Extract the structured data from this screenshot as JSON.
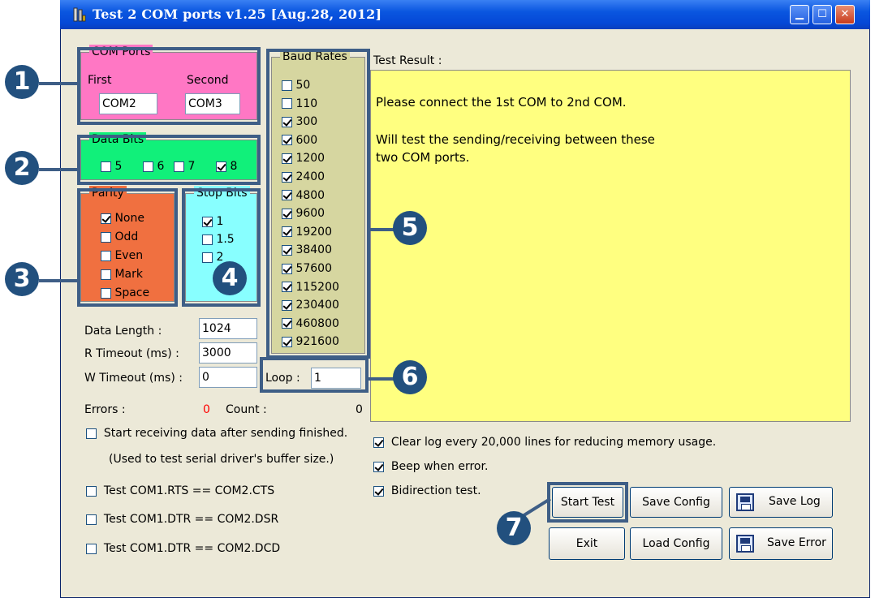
{
  "window": {
    "title": "Test 2 COM ports v1.25 [Aug.28, 2012]"
  },
  "callouts": [
    "1",
    "2",
    "3",
    "4",
    "5",
    "6",
    "7"
  ],
  "com_ports": {
    "title": "COM Ports",
    "first_label": "First",
    "second_label": "Second",
    "first_value": "COM2",
    "second_value": "COM3"
  },
  "data_bits": {
    "title": "Data Bits",
    "options": [
      {
        "label": "5",
        "checked": false
      },
      {
        "label": "6",
        "checked": false
      },
      {
        "label": "7",
        "checked": false
      },
      {
        "label": "8",
        "checked": true
      }
    ]
  },
  "parity": {
    "title": "Parity",
    "options": [
      {
        "label": "None",
        "checked": true
      },
      {
        "label": "Odd",
        "checked": false
      },
      {
        "label": "Even",
        "checked": false
      },
      {
        "label": "Mark",
        "checked": false
      },
      {
        "label": "Space",
        "checked": false
      }
    ]
  },
  "stop_bits": {
    "title": "Stop Bits",
    "options": [
      {
        "label": "1",
        "checked": true
      },
      {
        "label": "1.5",
        "checked": false
      },
      {
        "label": "2",
        "checked": false
      }
    ]
  },
  "baud_rates": {
    "title": "Baud Rates",
    "options": [
      {
        "label": "50",
        "checked": false
      },
      {
        "label": "110",
        "checked": false
      },
      {
        "label": "300",
        "checked": true
      },
      {
        "label": "600",
        "checked": true
      },
      {
        "label": "1200",
        "checked": true
      },
      {
        "label": "2400",
        "checked": true
      },
      {
        "label": "4800",
        "checked": true
      },
      {
        "label": "9600",
        "checked": true
      },
      {
        "label": "19200",
        "checked": true
      },
      {
        "label": "38400",
        "checked": true
      },
      {
        "label": "57600",
        "checked": true
      },
      {
        "label": "115200",
        "checked": true
      },
      {
        "label": "230400",
        "checked": true
      },
      {
        "label": "460800",
        "checked": true
      },
      {
        "label": "921600",
        "checked": true
      }
    ]
  },
  "fields": {
    "data_length_label": "Data Length :",
    "data_length_value": "1024",
    "r_timeout_label": "R Timeout (ms) :",
    "r_timeout_value": "3000",
    "w_timeout_label": "W Timeout (ms) :",
    "w_timeout_value": "0",
    "loop_label": "Loop :",
    "loop_value": "1"
  },
  "stats": {
    "errors_label": "Errors :",
    "errors_value": "0",
    "count_label": "Count :",
    "count_value": "0"
  },
  "options_left": [
    {
      "label": "Start receiving data after sending finished.",
      "checked": false
    },
    {
      "label": "Test COM1.RTS == COM2.CTS",
      "checked": false
    },
    {
      "label": "Test COM1.DTR == COM2.DSR",
      "checked": false
    },
    {
      "label": "Test COM1.DTR == COM2.DCD",
      "checked": false
    }
  ],
  "options_note": "(Used to test serial driver's buffer size.)",
  "test_result": {
    "label": "Test Result :",
    "line1": "Please connect the 1st COM to 2nd COM.",
    "line2": "Will test the sending/receiving between these",
    "line3": "two COM ports."
  },
  "options_right": [
    {
      "label": "Clear log every 20,000  lines for reducing memory usage.",
      "checked": true
    },
    {
      "label": "Beep when error.",
      "checked": true
    },
    {
      "label": "Bidirection test.",
      "checked": true
    }
  ],
  "buttons": {
    "start_test": "Start Test",
    "save_config": "Save Config",
    "save_log": "Save Log",
    "exit": "Exit",
    "load_config": "Load Config",
    "save_error": "Save Error"
  },
  "colors": {
    "com_ports_bg": "#ff77c4",
    "data_bits_bg": "#11f07a",
    "parity_bg": "#f07040",
    "stop_bits_bg": "#88ffff",
    "baud_rates_bg": "#d6d6a0",
    "result_bg": "#ffff80",
    "callout": "#22507e",
    "errors_value": "#ff0000"
  }
}
